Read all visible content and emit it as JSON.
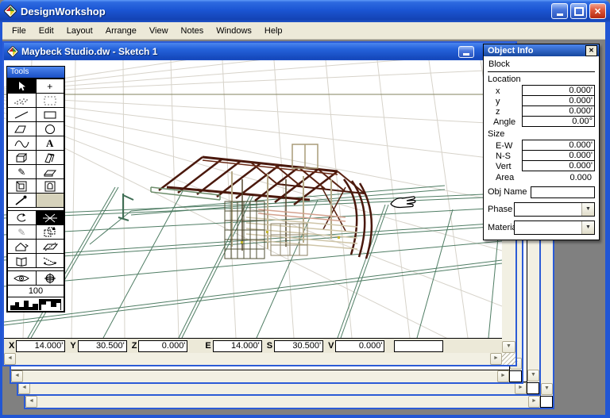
{
  "app": {
    "title": "DesignWorkshop"
  },
  "window_controls": {
    "minimize": "",
    "maximize": "",
    "close": "✕"
  },
  "menu": {
    "items": [
      "File",
      "Edit",
      "Layout",
      "Arrange",
      "View",
      "Notes",
      "Windows",
      "Help"
    ]
  },
  "document": {
    "title": "Maybeck Studio.dw - Sketch 1"
  },
  "tools": {
    "title": "Tools",
    "zoom_value": "100",
    "glyphs": {
      "crosshair": "+",
      "text": "A",
      "pencil": "✎",
      "measure": "✎"
    }
  },
  "object_info": {
    "title": "Object Info",
    "close": "✕",
    "type": "Block",
    "location_label": "Location",
    "loc_x_label": "x",
    "loc_x": "0.000'",
    "loc_y_label": "y",
    "loc_y": "0.000'",
    "loc_z_label": "z",
    "loc_z": "0.000'",
    "angle_label": "Angle",
    "angle": "0.00°",
    "size_label": "Size",
    "ew_label": "E-W",
    "ew": "0.000'",
    "ns_label": "N-S",
    "ns": "0.000'",
    "vert_label": "Vert",
    "vert": "0.000'",
    "area_label": "Area",
    "area": "0.000",
    "obj_name_label": "Obj Name",
    "obj_name": "",
    "phase_label": "Phase",
    "phase": "",
    "material_label": "Material",
    "material": ""
  },
  "coordinates": {
    "x_label": "X",
    "x": "14.000'",
    "y_label": "Y",
    "y": "30.500'",
    "z_label": "Z",
    "z": "0.000'",
    "e_label": "E",
    "e": "14.000'",
    "s_label": "S",
    "s": "30.500'",
    "v_label": "V",
    "v": "0.000'",
    "extra": ""
  },
  "scrollbar_glyphs": {
    "left": "◄",
    "right": "►",
    "up": "▲",
    "down": "▼",
    "dropdown": "▼"
  },
  "scene_colors": {
    "grid_gray": "#d7d3ca",
    "horizon_olive": "#83835c",
    "site_green": "#4f7d64",
    "frame_maroon": "#4a180c",
    "frame_tan": "#b5a988"
  }
}
